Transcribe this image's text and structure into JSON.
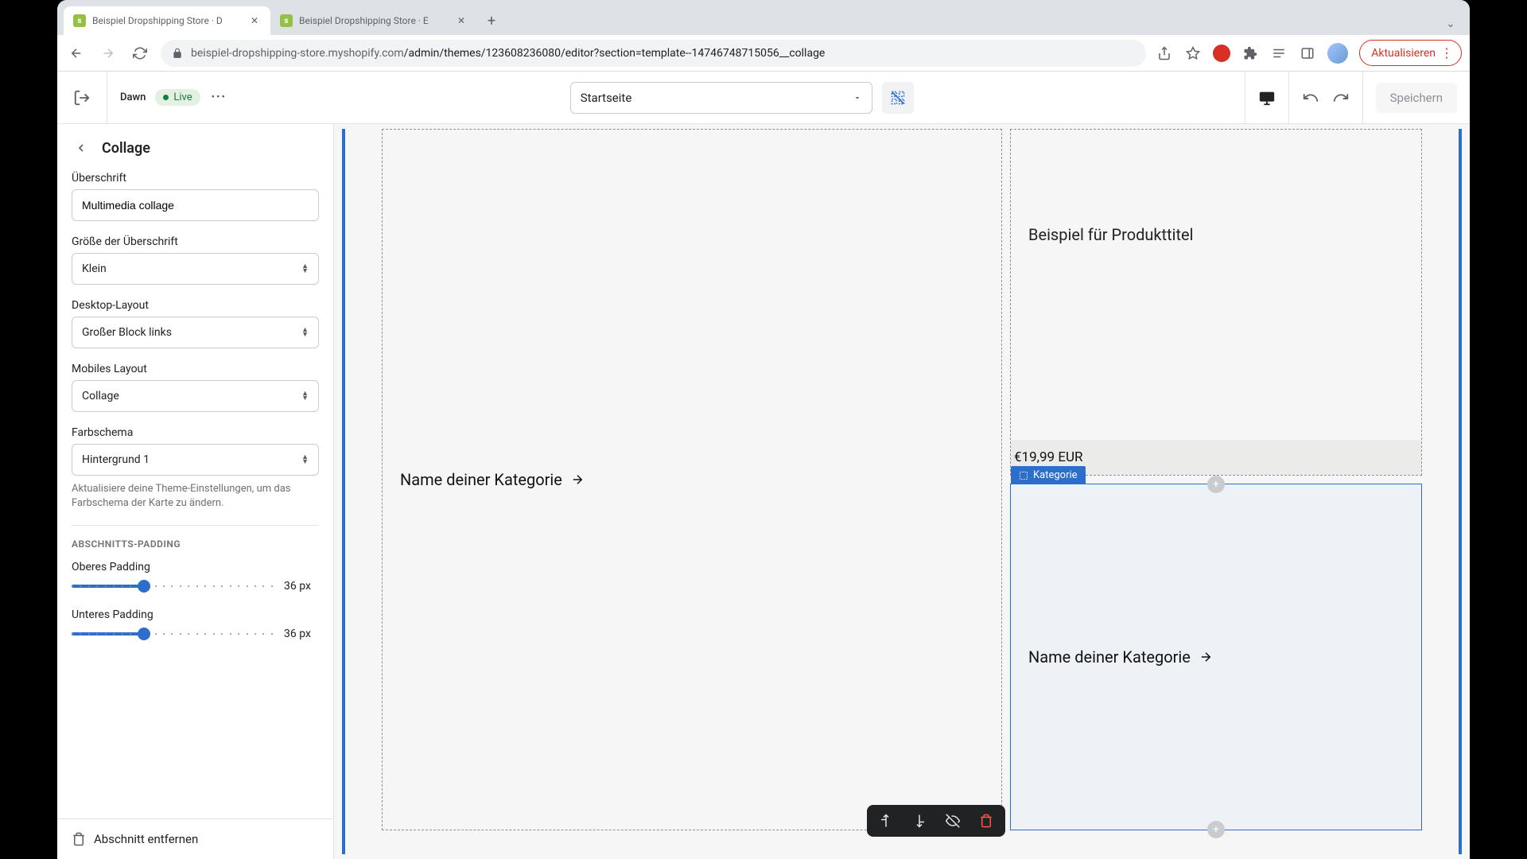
{
  "browser": {
    "tabs": [
      {
        "title": "Beispiel Dropshipping Store · D"
      },
      {
        "title": "Beispiel Dropshipping Store · E"
      }
    ],
    "url_host": "beispiel-dropshipping-store.myshopify.com",
    "url_path": "/admin/themes/123608236080/editor?section=template--14746748715056__collage",
    "update_label": "Aktualisieren"
  },
  "header": {
    "theme_name": "Dawn",
    "live_label": "Live",
    "page_selector": "Startseite",
    "save_label": "Speichern"
  },
  "sidebar": {
    "title": "Collage",
    "fields": {
      "heading_label": "Überschrift",
      "heading_value": "Multimedia collage",
      "heading_size_label": "Größe der Überschrift",
      "heading_size_value": "Klein",
      "desktop_layout_label": "Desktop-Layout",
      "desktop_layout_value": "Großer Block links",
      "mobile_layout_label": "Mobiles Layout",
      "mobile_layout_value": "Collage",
      "color_scheme_label": "Farbschema",
      "color_scheme_value": "Hintergrund 1",
      "color_help": "Aktualisiere deine Theme-Einstellungen, um das Farbschema der Karte zu ändern."
    },
    "padding_caption": "ABSCHNITTS-PADDING",
    "padding_top_label": "Oberes Padding",
    "padding_top_value": "36 px",
    "padding_bottom_label": "Unteres Padding",
    "padding_bottom_value": "36 px",
    "remove_label": "Abschnitt entfernen"
  },
  "preview": {
    "big_card_text": "Name deiner Kategorie",
    "product_title": "Beispiel für Produkttitel",
    "product_price": "€19,99 EUR",
    "block_tag": "Kategorie",
    "cat_card_text": "Name deiner Kategorie"
  }
}
